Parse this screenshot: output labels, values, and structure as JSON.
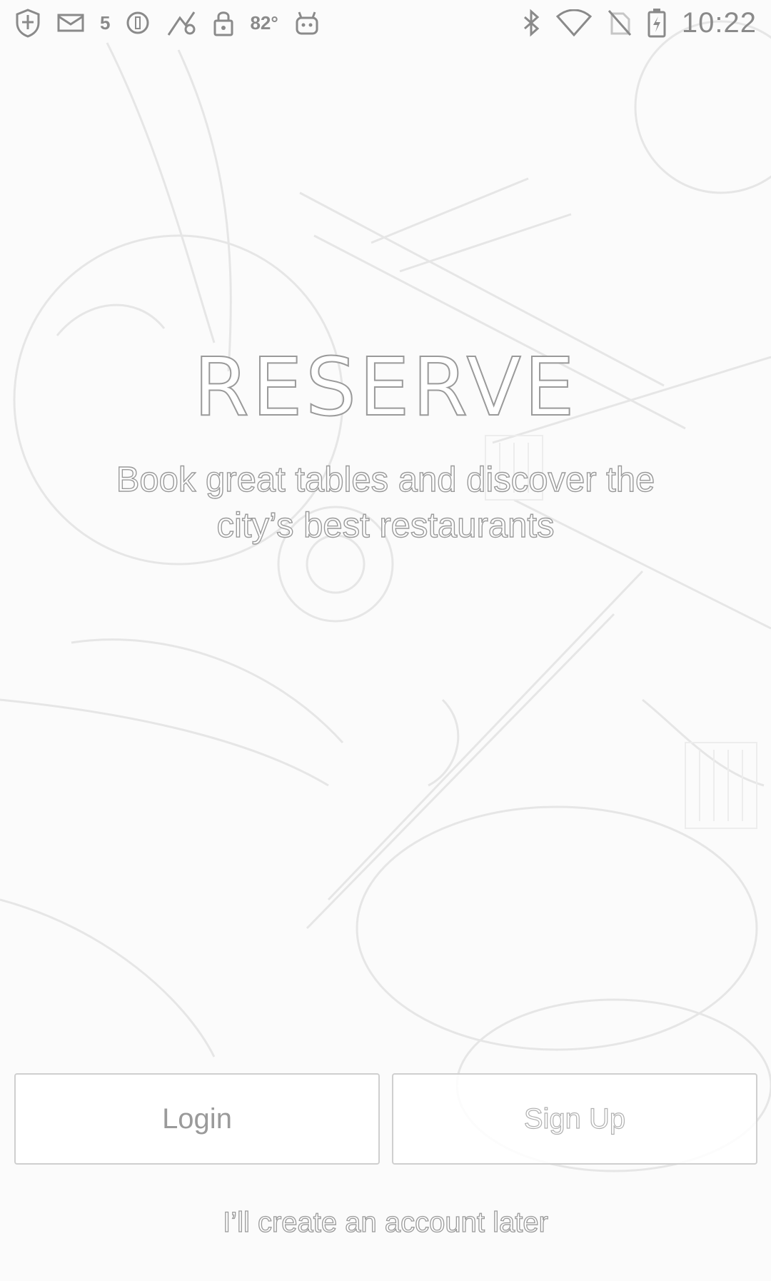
{
  "status_bar": {
    "left_icons": [
      "shield-icon",
      "mail-icon",
      "five-icon",
      "circle-icon",
      "fake-gps-icon",
      "lock-icon",
      "temperature-icon",
      "android-icon"
    ],
    "five_text": "5",
    "temperature": "82°",
    "right_icons": [
      "bluetooth-icon",
      "wifi-icon",
      "no-sim-icon",
      "battery-charging-icon"
    ],
    "time": "10:22"
  },
  "hero": {
    "brand": "RESERVE",
    "tagline_line1": "Book great tables and discover the",
    "tagline_line2": "city’s best restaurants"
  },
  "actions": {
    "login_label": "Login",
    "signup_label": "Sign Up",
    "later_label": "I’ll create an account later"
  },
  "colors": {
    "background": "#fbfbfb",
    "outline": "#9a9a9a",
    "button_border": "#cfcfcf"
  }
}
